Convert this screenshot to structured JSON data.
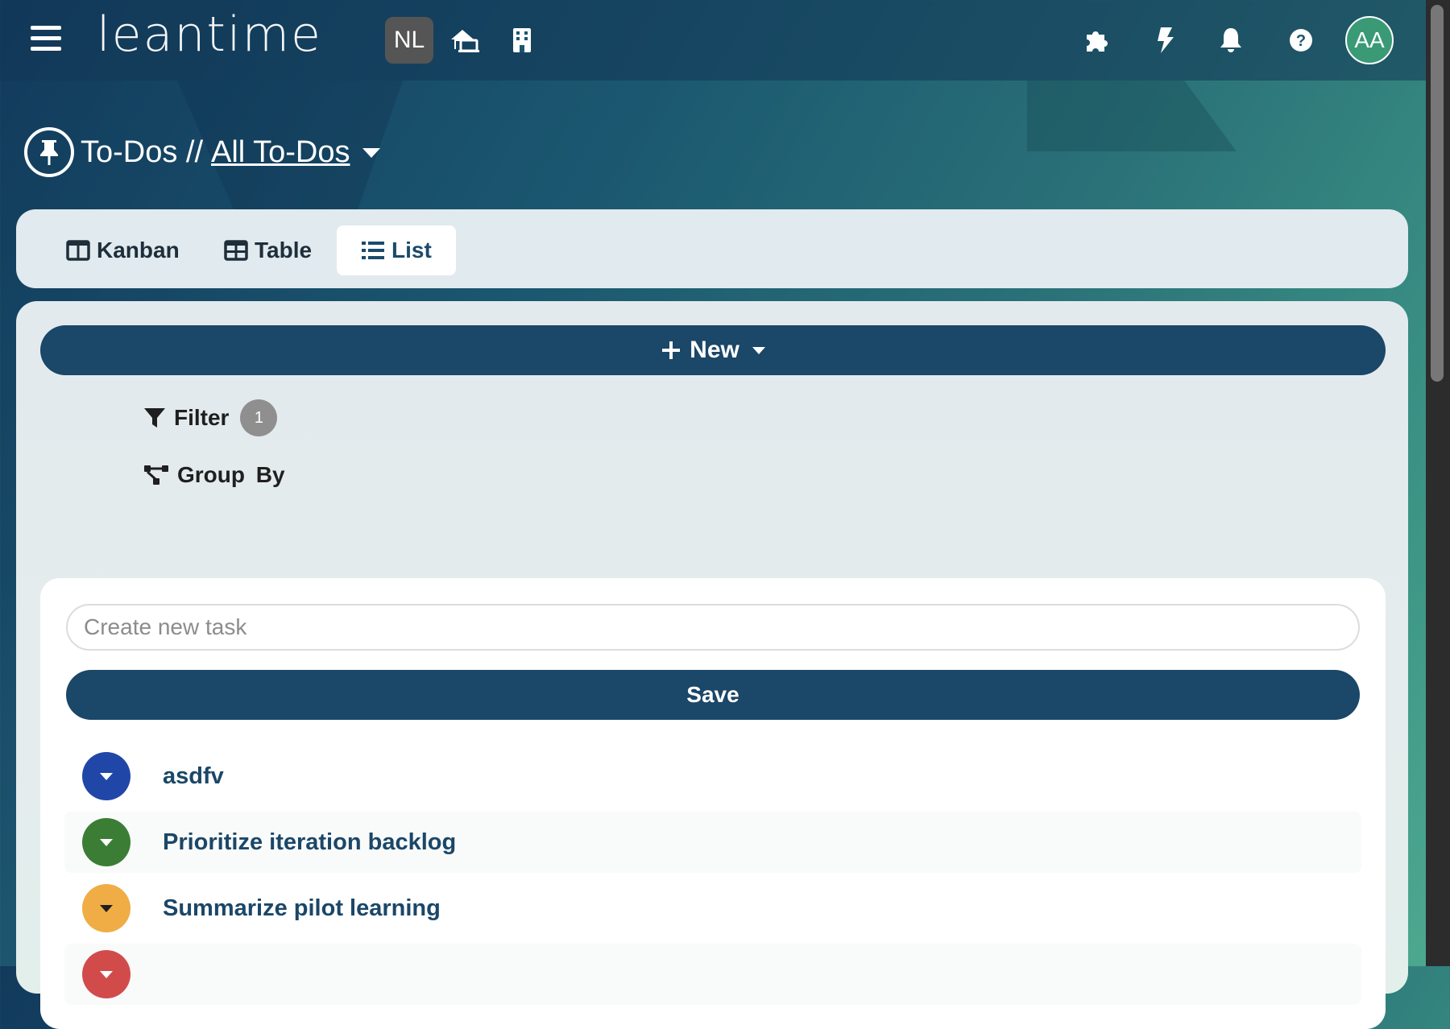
{
  "app": {
    "logo_text": "leantime"
  },
  "header": {
    "project_initials": "NL",
    "user_initials": "AA",
    "icons": [
      "hamburger-menu-icon",
      "my-work-icon",
      "company-icon",
      "apps-icon",
      "lightning-icon",
      "bell-icon",
      "help-icon"
    ]
  },
  "breadcrumb": {
    "module": "To-Dos //",
    "view": "All To-Dos"
  },
  "tabs": [
    {
      "label": "Kanban",
      "icon": "kanban-icon",
      "active": false
    },
    {
      "label": "Table",
      "icon": "table-icon",
      "active": false
    },
    {
      "label": "List",
      "icon": "list-icon",
      "active": true
    }
  ],
  "toolbar": {
    "new_label": "New",
    "filter_label": "Filter",
    "filter_count": "1",
    "groupby_label": "Group  By"
  },
  "task_form": {
    "placeholder": "Create new task",
    "value": "",
    "save_label": "Save"
  },
  "tasks": [
    {
      "title": "asdfv",
      "status_color": "#2047a8"
    },
    {
      "title": "Prioritize iteration backlog",
      "status_color": "#3b7d35"
    },
    {
      "title": "Summarize pilot learning",
      "status_color": "#f0ad45"
    },
    {
      "title": "",
      "status_color": "#d24b4b"
    }
  ],
  "colors": {
    "primary": "#1b4768",
    "avatar": "#3a9a76"
  }
}
